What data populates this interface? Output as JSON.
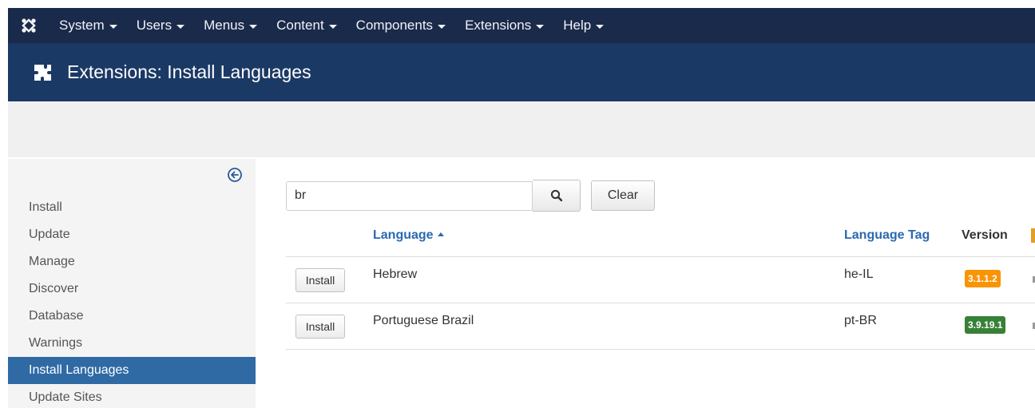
{
  "topnav": {
    "logo_icon": "joomla-logo-icon",
    "items": [
      {
        "label": "System"
      },
      {
        "label": "Users"
      },
      {
        "label": "Menus"
      },
      {
        "label": "Content"
      },
      {
        "label": "Components"
      },
      {
        "label": "Extensions"
      },
      {
        "label": "Help"
      }
    ]
  },
  "header": {
    "icon": "puzzle-piece-icon",
    "title": "Extensions: Install Languages"
  },
  "sidebar": {
    "collapse_icon": "arrow-circle-left-icon",
    "items": [
      {
        "label": "Install",
        "active": false
      },
      {
        "label": "Update",
        "active": false
      },
      {
        "label": "Manage",
        "active": false
      },
      {
        "label": "Discover",
        "active": false
      },
      {
        "label": "Database",
        "active": false
      },
      {
        "label": "Warnings",
        "active": false
      },
      {
        "label": "Install Languages",
        "active": true
      },
      {
        "label": "Update Sites",
        "active": false
      }
    ]
  },
  "search": {
    "value": "br",
    "search_icon": "search-icon",
    "clear_label": "Clear"
  },
  "table": {
    "columns": {
      "language": "Language",
      "language_tag": "Language Tag",
      "version": "Version"
    },
    "rows": [
      {
        "action": "Install",
        "language": "Hebrew",
        "tag": "he-IL",
        "version": "3.1.1.2",
        "version_status": "warning"
      },
      {
        "action": "Install",
        "language": "Portuguese Brazil",
        "tag": "pt-BR",
        "version": "3.9.19.1",
        "version_status": "success"
      }
    ]
  },
  "colors": {
    "nav_bg": "#1a2a4a",
    "header_bg": "#1b3965",
    "active_item": "#2f6aa5",
    "link": "#2a69b2",
    "badge_warning": "#f89406",
    "badge_success": "#378137"
  }
}
